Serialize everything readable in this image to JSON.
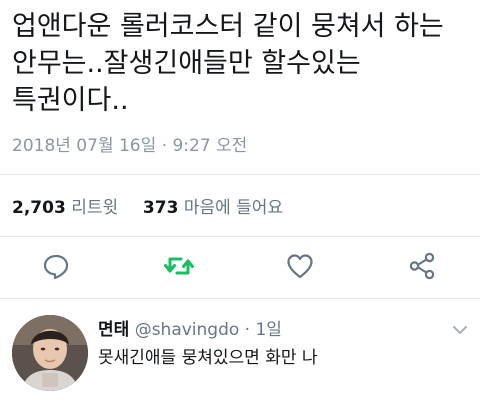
{
  "tweet": {
    "text_lines": [
      "업앤다운 롤러코스터 같이 뭉쳐서 하는",
      "안무는..잘생긴애들만 할수있는",
      "특권이다.."
    ],
    "timestamp": "2018년 07월 16일 · 9:27 오전"
  },
  "stats": {
    "retweets_count": "2,703",
    "retweets_label": "리트윗",
    "likes_count": "373",
    "likes_label": "마음에 들어요"
  },
  "actions": [
    {
      "name": "reply",
      "icon": "reply-icon"
    },
    {
      "name": "retweet",
      "icon": "retweet-icon"
    },
    {
      "name": "like",
      "icon": "heart-icon"
    },
    {
      "name": "share",
      "icon": "share-icon"
    }
  ],
  "reply": {
    "display_name": "면태",
    "handle_time": "@shavingdo · 1일",
    "text": "못새긴애들 뭉쳐있으면 화만 나"
  },
  "colors": {
    "text": "#14171a",
    "muted": "#8a96a3",
    "icon_gray": "#657786",
    "retweet_green": "#17bf63",
    "divider": "#e1e8ed"
  }
}
